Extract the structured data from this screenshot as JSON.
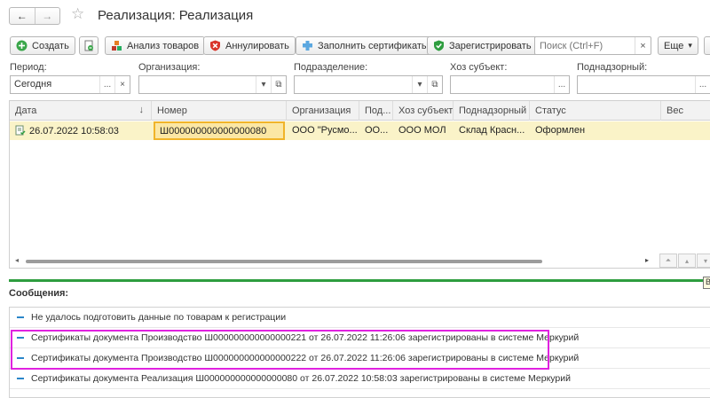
{
  "window": {
    "title": "Реализация: Реализация",
    "back_icon": "←",
    "forward_icon": "→",
    "star_icon": "☆"
  },
  "toolbar": {
    "create": "Создать",
    "analysis": "Анализ товаров",
    "cancel": "Аннулировать",
    "fill_certs": "Заполнить сертификаты",
    "register": "Зарегистрировать",
    "search_placeholder": "Поиск (Ctrl+F)",
    "clear": "×",
    "more": "Еще",
    "more_arrow": "▾"
  },
  "filters": {
    "period": {
      "label": "Период:",
      "value": "Сегодня",
      "select": "...",
      "clear": "×"
    },
    "organization": {
      "label": "Организация:",
      "value": "",
      "dropdown": "▾",
      "open": "⧉"
    },
    "department": {
      "label": "Подразделение:",
      "value": "",
      "dropdown": "▾",
      "open": "⧉"
    },
    "entity": {
      "label": "Хоз субъект:",
      "value": "",
      "select": "..."
    },
    "supervised": {
      "label": "Поднадзорный:",
      "value": "",
      "select": "..."
    }
  },
  "table": {
    "columns": [
      "Дата",
      "Номер",
      "Организация",
      "Под...",
      "Хоз субъект",
      "Поднадзорный",
      "Статус",
      "Вес"
    ],
    "sort_indicator": "↓",
    "rows": [
      [
        "26.07.2022 10:58:03",
        "Ш000000000000000080",
        "ООО \"Русмо...",
        "ОО...",
        "ООО  МОЛ",
        "Склад Красн...",
        "Оформлен",
        ""
      ]
    ]
  },
  "scroll": {
    "left": "◂",
    "right": "▸",
    "first": "⏶",
    "up": "▴",
    "down": "▾"
  },
  "messages": {
    "title": "Сообщения:",
    "items": [
      "Не удалось подготовить данные по товарам к регистрации",
      "Сертификаты документа Производство Ш000000000000000221 от 26.07.2022 11:26:06 зарегистрированы в системе Меркурий",
      "Сертификаты документа Производство Ш000000000000000222 от 26.07.2022 11:26:06 зарегистрированы в системе Меркурий",
      "Сертификаты документа Реализация Ш000000000000000080 от 26.07.2022 10:58:03 зарегистрированы в системе Меркурий"
    ]
  },
  "tooltip": {
    "letter": "В"
  },
  "colors": {
    "accent_green": "#2e9d3f",
    "row_selected": "#faf3c8",
    "cell_focus": "#f0b429",
    "highlight": "#e022e0",
    "message_dash": "#2a86c9"
  }
}
